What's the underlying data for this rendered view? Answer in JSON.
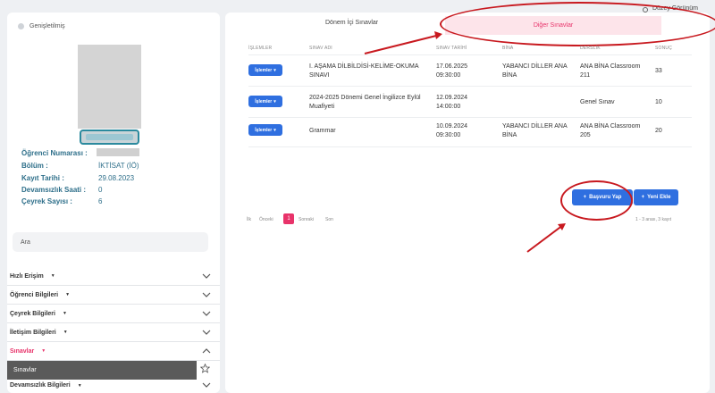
{
  "sidebar": {
    "expand_label": "Genişletilmiş",
    "info": [
      {
        "label": "Öğrenci Numarası :",
        "value": ""
      },
      {
        "label": "Bölüm :",
        "value": "İKTİSAT (İÖ)"
      },
      {
        "label": "Kayıt Tarihi :",
        "value": "29.08.2023"
      },
      {
        "label": "Devamsızlık Saati :",
        "value": "0"
      },
      {
        "label": "Çeyrek Sayısı :",
        "value": "6"
      }
    ],
    "search_placeholder": "Ara",
    "menu": [
      {
        "label": "Hızlı Erişim"
      },
      {
        "label": "Öğrenci Bilgileri"
      },
      {
        "label": "Çeyrek Bilgileri"
      },
      {
        "label": "İletişim Bilgileri"
      },
      {
        "label": "Sınavlar"
      },
      {
        "label": "Devamsızlık Bilgileri"
      }
    ],
    "active_subitem": "Sınavlar"
  },
  "main": {
    "view_toggle": "Düzey Görünüm",
    "tabs": [
      "Dönem İçi Sınavlar",
      "Diğer Sınavlar"
    ],
    "active_tab_index": 1,
    "table": {
      "headers": [
        "İŞLEMLER",
        "SINAV ADI",
        "SINAV TARİHİ",
        "BİNA",
        "DERSLİK",
        "SONUÇ"
      ],
      "action_label": "İşlemler",
      "rows": [
        {
          "name": [
            "I. AŞAMA DİLBİLDİSİ-KELİME-OKUMA",
            "SINAVI"
          ],
          "date": [
            "17.06.2025",
            "09:30:00"
          ],
          "building": [
            "YABANCI DİLLER ANA",
            "BİNA"
          ],
          "room": [
            "ANA BİNA Classroom",
            "211"
          ],
          "result": "33"
        },
        {
          "name": [
            "2024-2025 Dönemi Genel İngilizce Eylül",
            "Muafiyeti"
          ],
          "date": [
            "12.09.2024",
            "14:00:00"
          ],
          "building": [
            "",
            ""
          ],
          "room": [
            "Genel Sınav",
            ""
          ],
          "result": "10"
        },
        {
          "name": [
            "Grammar",
            ""
          ],
          "date": [
            "10.09.2024",
            "09:30:00"
          ],
          "building": [
            "YABANCI DİLLER ANA",
            "BİNA"
          ],
          "room": [
            "ANA BİNA Classroom",
            "205"
          ],
          "result": "20"
        }
      ]
    },
    "buttons": {
      "apply": "Başvuru Yap",
      "add": "Yeni Ekle"
    },
    "pagination": {
      "first": "İlk",
      "prev": "Önceki",
      "current": "1",
      "next": "Sonraki",
      "last": "Son",
      "info": "1 - 3 arası, 3 kayıt"
    }
  }
}
